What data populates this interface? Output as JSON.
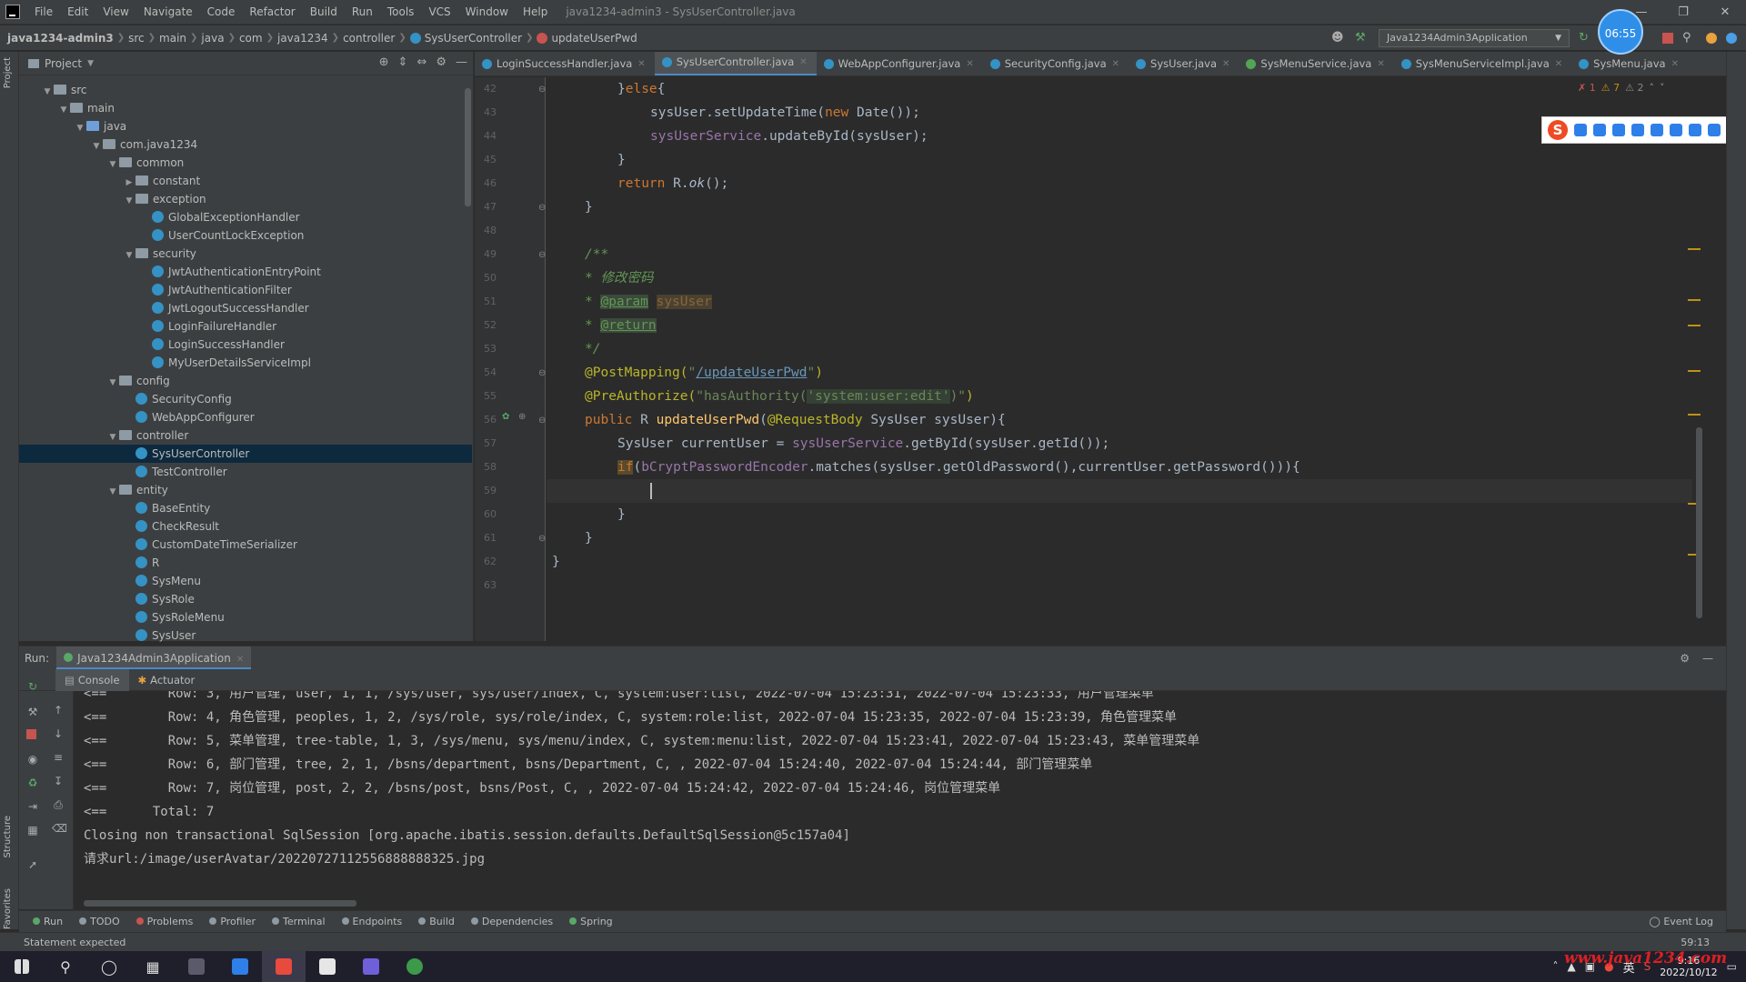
{
  "menu": {
    "items": [
      "File",
      "Edit",
      "View",
      "Navigate",
      "Code",
      "Refactor",
      "Build",
      "Run",
      "Tools",
      "VCS",
      "Window",
      "Help"
    ],
    "window_title": "java1234-admin3 - SysUserController.java"
  },
  "navbar": {
    "crumbs": [
      "java1234-admin3",
      "src",
      "main",
      "java",
      "com",
      "java1234",
      "controller",
      "SysUserController",
      "updateUserPwd"
    ],
    "run_config": "Java1234Admin3Application",
    "clock": "06:55"
  },
  "left_stripe": {
    "label_top": "Project",
    "label_mid": "Structure",
    "label_bottom": "Favorites"
  },
  "project": {
    "title": "Project",
    "tree": [
      {
        "label": "src",
        "depth": 0,
        "kind": "folder",
        "open": true
      },
      {
        "label": "main",
        "depth": 1,
        "kind": "folder",
        "open": true
      },
      {
        "label": "java",
        "depth": 2,
        "kind": "folder-blue",
        "open": true
      },
      {
        "label": "com.java1234",
        "depth": 3,
        "kind": "folder",
        "open": true
      },
      {
        "label": "common",
        "depth": 4,
        "kind": "folder",
        "open": true
      },
      {
        "label": "constant",
        "depth": 5,
        "kind": "folder",
        "open": false
      },
      {
        "label": "exception",
        "depth": 5,
        "kind": "folder",
        "open": true
      },
      {
        "label": "GlobalExceptionHandler",
        "depth": 6,
        "kind": "class"
      },
      {
        "label": "UserCountLockException",
        "depth": 6,
        "kind": "class"
      },
      {
        "label": "security",
        "depth": 5,
        "kind": "folder",
        "open": true
      },
      {
        "label": "JwtAuthenticationEntryPoint",
        "depth": 6,
        "kind": "class"
      },
      {
        "label": "JwtAuthenticationFilter",
        "depth": 6,
        "kind": "class"
      },
      {
        "label": "JwtLogoutSuccessHandler",
        "depth": 6,
        "kind": "class"
      },
      {
        "label": "LoginFailureHandler",
        "depth": 6,
        "kind": "class"
      },
      {
        "label": "LoginSuccessHandler",
        "depth": 6,
        "kind": "class"
      },
      {
        "label": "MyUserDetailsServiceImpl",
        "depth": 6,
        "kind": "class"
      },
      {
        "label": "config",
        "depth": 4,
        "kind": "folder",
        "open": true
      },
      {
        "label": "SecurityConfig",
        "depth": 5,
        "kind": "class"
      },
      {
        "label": "WebAppConfigurer",
        "depth": 5,
        "kind": "class"
      },
      {
        "label": "controller",
        "depth": 4,
        "kind": "folder",
        "open": true
      },
      {
        "label": "SysUserController",
        "depth": 5,
        "kind": "class",
        "selected": true
      },
      {
        "label": "TestController",
        "depth": 5,
        "kind": "class"
      },
      {
        "label": "entity",
        "depth": 4,
        "kind": "folder",
        "open": true
      },
      {
        "label": "BaseEntity",
        "depth": 5,
        "kind": "class"
      },
      {
        "label": "CheckResult",
        "depth": 5,
        "kind": "class"
      },
      {
        "label": "CustomDateTimeSerializer",
        "depth": 5,
        "kind": "class"
      },
      {
        "label": "R",
        "depth": 5,
        "kind": "class"
      },
      {
        "label": "SysMenu",
        "depth": 5,
        "kind": "class"
      },
      {
        "label": "SysRole",
        "depth": 5,
        "kind": "class"
      },
      {
        "label": "SysRoleMenu",
        "depth": 5,
        "kind": "class"
      },
      {
        "label": "SysUser",
        "depth": 5,
        "kind": "class"
      }
    ]
  },
  "editor_tabs": [
    {
      "label": "LoginSuccessHandler.java",
      "active": false
    },
    {
      "label": "SysUserController.java",
      "active": true
    },
    {
      "label": "WebAppConfigurer.java",
      "active": false
    },
    {
      "label": "SecurityConfig.java",
      "active": false
    },
    {
      "label": "SysUser.java",
      "active": false
    },
    {
      "label": "SysMenuService.java",
      "active": false,
      "interface": true
    },
    {
      "label": "SysMenuServiceImpl.java",
      "active": false
    },
    {
      "label": "SysMenu.java",
      "active": false
    }
  ],
  "inspections": {
    "errors": "1",
    "warnings1": "7",
    "warnings2": "2"
  },
  "code": {
    "line_numbers": [
      "42",
      "43",
      "44",
      "45",
      "46",
      "47",
      "48",
      "49",
      "50",
      "51",
      "52",
      "53",
      "54",
      "55",
      "56",
      "57",
      "58",
      "59",
      "60",
      "61",
      "62",
      "63"
    ],
    "l42": {
      "a": "}",
      "b": "else",
      "c": "{"
    },
    "l43": {
      "a": "sysUser.setUpdateTime(",
      "b": "new",
      "c": " Date());"
    },
    "l44": {
      "a": "sysUserService",
      "b": ".updateById(sysUser);"
    },
    "l45": "}",
    "l46": {
      "a": "return",
      "b": " R.",
      "c": "ok",
      "d": "();"
    },
    "l47": "}",
    "l49": "/**",
    "l50": {
      "a": "* ",
      "b": "修改密码"
    },
    "l51": {
      "a": "* ",
      "b": "@param",
      "c": "sysUser"
    },
    "l52": {
      "a": "* ",
      "b": "@return"
    },
    "l53": "*/",
    "l54": {
      "a": "@PostMapping(",
      "b": "\"",
      "c": "/updateUserPwd",
      "d": "\"",
      "e": ")"
    },
    "l55": {
      "a": "@PreAuthorize(",
      "b": "\"hasAuthority(",
      "c": "'system:user:edit'",
      "d": ")\"",
      "e": ")"
    },
    "l56": {
      "a": "public",
      "b": " R ",
      "c": "updateUserPwd",
      "d": "(",
      "e": "@RequestBody",
      "f": " SysUser sysUser){"
    },
    "l57": {
      "a": "SysUser currentUser = ",
      "b": "sysUserService",
      "c": ".getById(sysUser.getId());"
    },
    "l58": {
      "a": "if",
      "b": "(",
      "c": "bCryptPasswordEncoder",
      "d": ".matches(sysUser.getOldPassword(),currentUser.getPassword())){"
    },
    "l60": "}",
    "l61": "}",
    "l62": "}"
  },
  "run": {
    "label": "Run:",
    "tab": "Java1234Admin3Application",
    "subtabs": [
      "Console",
      "Actuator"
    ],
    "console": [
      "<==        Row: 3, 用户管理, user, 1, 1, /sys/user, sys/user/index, C, system:user:list, 2022-07-04 15:23:31, 2022-07-04 15:23:33, 用户管理菜单",
      "<==        Row: 4, 角色管理, peoples, 1, 2, /sys/role, sys/role/index, C, system:role:list, 2022-07-04 15:23:35, 2022-07-04 15:23:39, 角色管理菜单",
      "<==        Row: 5, 菜单管理, tree-table, 1, 3, /sys/menu, sys/menu/index, C, system:menu:list, 2022-07-04 15:23:41, 2022-07-04 15:23:43, 菜单管理菜单",
      "<==        Row: 6, 部门管理, tree, 2, 1, /bsns/department, bsns/Department, C, , 2022-07-04 15:24:40, 2022-07-04 15:24:44, 部门管理菜单",
      "<==        Row: 7, 岗位管理, post, 2, 2, /bsns/post, bsns/Post, C, , 2022-07-04 15:24:42, 2022-07-04 15:24:46, 岗位管理菜单",
      "<==      Total: 7",
      "Closing non transactional SqlSession [org.apache.ibatis.session.defaults.DefaultSqlSession@5c157a04]",
      "请求url:/image/userAvatar/20220727112556888888325.jpg"
    ]
  },
  "toolbar": {
    "items": [
      "Run",
      "TODO",
      "Problems",
      "Profiler",
      "Terminal",
      "Endpoints",
      "Build",
      "Dependencies",
      "Spring"
    ],
    "event_log": "Event Log"
  },
  "status": {
    "message": "Statement expected",
    "position": "59:13"
  },
  "taskbar": {
    "time": "9:16",
    "date": "2022/10/12",
    "ime": "英"
  },
  "watermark": "www.java1234.com",
  "colors": {
    "accent": "#4a88c7",
    "editor_bg": "#2b2b2b",
    "panel_bg": "#3c3f41",
    "keyword": "#cc7832",
    "method": "#ffc66d",
    "field": "#9876aa",
    "string": "#6a8759",
    "comment": "#629755"
  }
}
